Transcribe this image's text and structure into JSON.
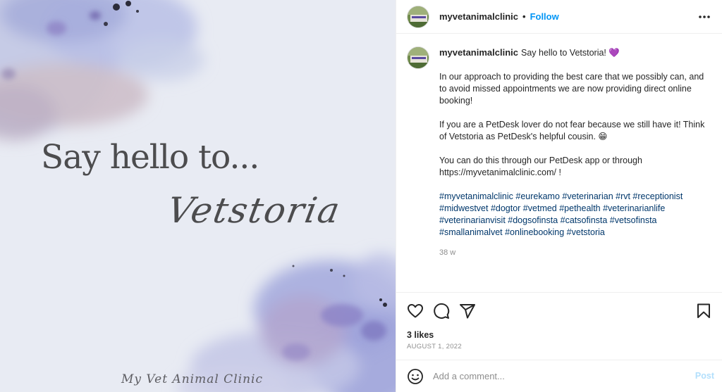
{
  "image": {
    "headline": "Say hello to...",
    "script_title": "Vetstoria",
    "signature": "My Vet Animal Clinic"
  },
  "header": {
    "username": "myvetanimalclinic",
    "separator": "•",
    "follow_label": "Follow",
    "more_icon": "more-options-icon"
  },
  "caption": {
    "username": "myvetanimalclinic",
    "first_line": "Say hello to Vetstoria! 💜",
    "paragraphs": [
      "In our approach to providing the best care that we possibly can, and to avoid missed appointments we are now providing direct online booking!",
      "If you are a PetDesk lover do not fear because we still have it! Think of Vetstoria as PetDesk's helpful cousin. 😁",
      "You can do this through our PetDesk app or through https://myvetanimalclinic.com/ !"
    ],
    "hashtags": "#myvetanimalclinic #eurekamo #veterinarian #rvt #receptionist #midwestvet #dogtor #vetmed #pethealth #veterinarianlife #veterinarianvisit #dogsofinsta #catsofinsta #vetsofinsta #smallanimalvet #onlinebooking #vetstoria",
    "time_ago": "38 w"
  },
  "actions": {
    "icons": [
      "heart-icon",
      "comment-icon",
      "share-icon",
      "bookmark-icon"
    ]
  },
  "likes": "3 likes",
  "date": "AUGUST 1, 2022",
  "comment": {
    "placeholder": "Add a comment...",
    "post_label": "Post"
  },
  "colors": {
    "accent": "#0095f6",
    "hashtag": "#00376b",
    "muted": "#8e8e8e",
    "post_disabled": "#b2dffc"
  }
}
